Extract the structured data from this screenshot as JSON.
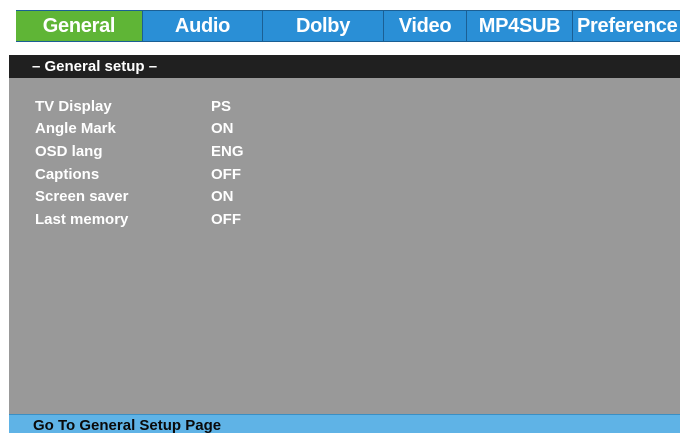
{
  "tabs": [
    {
      "label": "General",
      "active": true
    },
    {
      "label": "Audio",
      "active": false
    },
    {
      "label": "Dolby",
      "active": false
    },
    {
      "label": "Video",
      "active": false
    },
    {
      "label": "MP4SUB",
      "active": false
    },
    {
      "label": "Preference",
      "active": false
    }
  ],
  "section": {
    "title": "– General setup –"
  },
  "settings": [
    {
      "label": "TV Display",
      "value": "PS"
    },
    {
      "label": "Angle Mark",
      "value": "ON"
    },
    {
      "label": "OSD lang",
      "value": "ENG"
    },
    {
      "label": "Captions",
      "value": "OFF"
    },
    {
      "label": "Screen saver",
      "value": "ON"
    },
    {
      "label": "Last memory",
      "value": "OFF"
    }
  ],
  "status": {
    "text": "Go To General Setup Page"
  },
  "colors": {
    "tab_bg": "#2a8fd6",
    "tab_active_bg": "#5fb536",
    "panel_bg": "#999999",
    "header_bg": "#202020",
    "status_bg": "#5fb3e6"
  }
}
